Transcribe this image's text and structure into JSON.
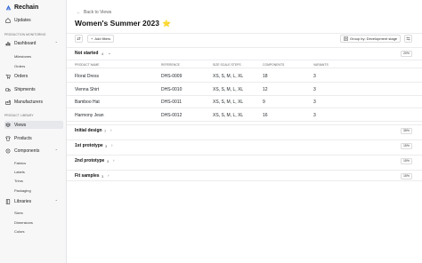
{
  "app": {
    "name": "Rechain"
  },
  "sidebar": {
    "updates": "Updates",
    "section_production": "PRODUCTION MONITORING",
    "dashboard": "Dashboard",
    "dashboard_sub": [
      "Milestones",
      "Orders"
    ],
    "orders": "Orders",
    "shipments": "Shipments",
    "manufacturers": "Manufacturers",
    "section_library": "PRODUCT LIBRARY",
    "views": "Views",
    "products": "Products",
    "components": "Components",
    "components_sub": [
      "Fabrics",
      "Labels",
      "Trims",
      "Packaging"
    ],
    "libraries": "Libraries",
    "libraries_sub": [
      "Sizes",
      "Dimensions",
      "Colors"
    ]
  },
  "main": {
    "back_label": "Back to Views",
    "title": "Women's Summer 2023",
    "title_emoji": "⭐",
    "add_filters": "Add filters",
    "group_by": "Group by: Development stage",
    "groups": [
      {
        "name": "Not started",
        "count": "4",
        "percent": "20%"
      },
      {
        "name": "Initial design",
        "count": "7",
        "percent": "35%"
      },
      {
        "name": "1st prototype",
        "count": "3",
        "percent": "15%"
      },
      {
        "name": "2nd prototype",
        "count": "3",
        "percent": "15%"
      },
      {
        "name": "Fit samples",
        "count": "3",
        "percent": "15%"
      }
    ],
    "table": {
      "headers": [
        "PRODUCT NAME",
        "REFERENCE",
        "SIZE SCALE STEPS",
        "COMPONENTS",
        "VARIANTS"
      ],
      "rows": [
        [
          "Floral Dress",
          "DHS-0009",
          "XS, S, M, L, XL",
          "18",
          "3"
        ],
        [
          "Vienna Shirt",
          "DHS-0010",
          "XS, S, M, L, XL",
          "12",
          "3"
        ],
        [
          "Bamboo Hat",
          "DHS-0011",
          "XS, S, M, L, XL",
          "9",
          "3"
        ],
        [
          "Harmony Jean",
          "DHS-0012",
          "XS, S, M, L, XL",
          "16",
          "3"
        ]
      ]
    }
  },
  "colors": {
    "accent_active": "#e7e8ec",
    "star": "#f2b705",
    "logo": "#3b6fd8"
  }
}
